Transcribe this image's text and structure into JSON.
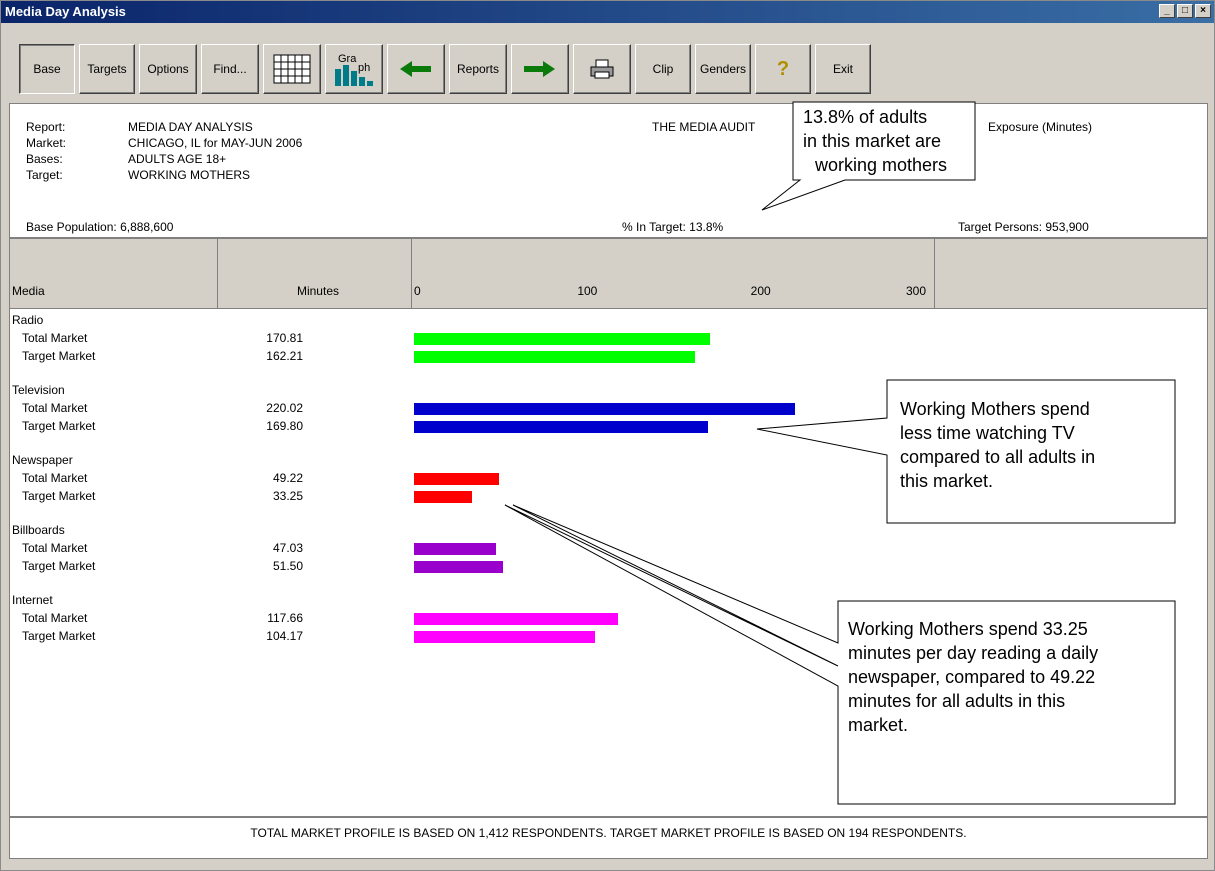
{
  "window": {
    "title": "Media Day Analysis"
  },
  "toolbar": {
    "base": "Base",
    "targets": "Targets",
    "options": "Options",
    "find": "Find...",
    "reports": "Reports",
    "clip": "Clip",
    "genders": "Genders",
    "exit": "Exit",
    "graph_lines": [
      "Gra",
      "ph"
    ]
  },
  "header": {
    "report_label": "Report:",
    "report": "MEDIA DAY ANALYSIS",
    "market_label": "Market:",
    "market": "CHICAGO, IL for MAY-JUN 2006",
    "bases_label": "Bases:",
    "bases": "ADULTS AGE 18+",
    "target_label": "Target:",
    "target": "WORKING MOTHERS",
    "source": "THE MEDIA AUDIT",
    "exposure": "Exposure (Minutes)",
    "base_population": "Base Population: 6,888,600",
    "pct_in_target": "% In Target: 13.8%",
    "target_persons": "Target Persons: 953,900"
  },
  "grid": {
    "col_media": "Media",
    "col_minutes": "Minutes",
    "ticks": [
      "0",
      "100",
      "200",
      "300"
    ]
  },
  "chart_data": {
    "type": "bar",
    "xlim": [
      0,
      300
    ],
    "groups": [
      {
        "name": "Radio",
        "color": "#00ff00",
        "rows": [
          {
            "label": "Total Market",
            "minutes_text": "170.81",
            "value": 170.81
          },
          {
            "label": "Target Market",
            "minutes_text": "162.21",
            "value": 162.21
          }
        ]
      },
      {
        "name": "Television",
        "color": "#0000cc",
        "rows": [
          {
            "label": "Total Market",
            "minutes_text": "220.02",
            "value": 220.02
          },
          {
            "label": "Target Market",
            "minutes_text": "169.80",
            "value": 169.8
          }
        ]
      },
      {
        "name": "Newspaper",
        "color": "#ff0000",
        "rows": [
          {
            "label": "Total Market",
            "minutes_text": "49.22",
            "value": 49.22
          },
          {
            "label": "Target Market",
            "minutes_text": "33.25",
            "value": 33.25
          }
        ]
      },
      {
        "name": "Billboards",
        "color": "#9900cc",
        "rows": [
          {
            "label": "Total Market",
            "minutes_text": "47.03",
            "value": 47.03
          },
          {
            "label": "Target Market",
            "minutes_text": "51.50",
            "value": 51.5
          }
        ]
      },
      {
        "name": "Internet",
        "color": "#ff00ff",
        "rows": [
          {
            "label": "Total Market",
            "minutes_text": "117.66",
            "value": 117.66
          },
          {
            "label": "Target Market",
            "minutes_text": "104.17",
            "value": 104.17
          }
        ]
      }
    ]
  },
  "footer": "TOTAL MARKET PROFILE IS BASED ON 1,412 RESPONDENTS.  TARGET MARKET PROFILE IS BASED ON 194 RESPONDENTS.",
  "callouts": {
    "target_pct": [
      "13.8% of adults",
      "in this market are",
      "working mothers"
    ],
    "tv": [
      "Working Mothers spend",
      "less time watching TV",
      "compared to all adults in",
      "this market."
    ],
    "newspaper": [
      "Working Mothers spend 33.25",
      "minutes per day reading a daily",
      "newspaper, compared to 49.22",
      "minutes for all adults in this",
      "market."
    ]
  }
}
